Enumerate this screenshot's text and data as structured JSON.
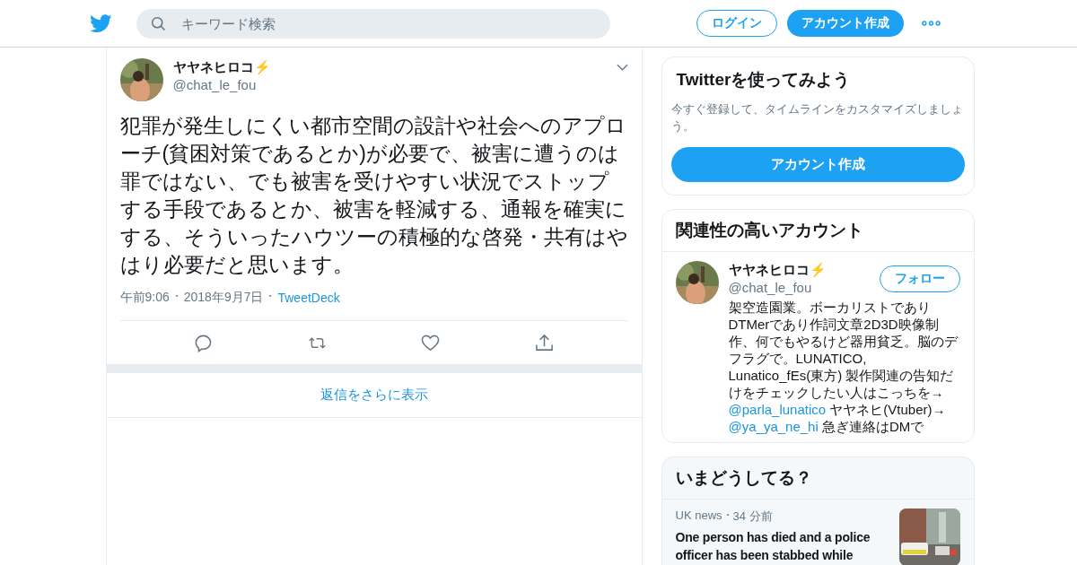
{
  "header": {
    "search": {
      "placeholder": "キーワード検索"
    },
    "login": "ログイン",
    "signup": "アカウント作成"
  },
  "tweet": {
    "name": "ヤヤネヒロコ⚡",
    "handle": "@chat_le_fou",
    "text": "犯罪が発生しにくい都市空間の設計や社会へのアプローチ(貧困対策であるとか)が必要で、被害に遭うのは罪ではない、でも被害を受けやすい状況でストップする手段であるとか、被害を軽減する、通報を確実にする、そういったハウツーの積極的な啓発・共有はやはり必要だと思います。",
    "time": "午前9:06",
    "date": "2018年9月7日",
    "source": "TweetDeck"
  },
  "more_replies": "返信をさらに表示",
  "signup_card": {
    "title": "Twitterを使ってみよう",
    "text": "今すぐ登録して、タイムラインをカスタマイズしましょう。",
    "button": "アカウント作成"
  },
  "related": {
    "title": "関連性の高いアカウント",
    "account": {
      "name": "ヤヤネヒロコ⚡",
      "handle": "@chat_le_fou",
      "follow": "フォロー",
      "bio": [
        {
          "kind": "text",
          "text": "架空造園業。ボーカリストでありDTMerであり作詞文章2D3D映像制作、何でもやるけど器用貧乏。脳のデフラグで。LUNATICO, Lunatico_fEs(東方) 製作関連の告知だけをチェックしたい人はこっちを→ "
        },
        {
          "kind": "mention",
          "text": "@parla_lunatico"
        },
        {
          "kind": "text",
          "text": " ヤヤネヒ(Vtuber)→ "
        },
        {
          "kind": "mention",
          "text": "@ya_ya_ne_hi"
        },
        {
          "kind": "text",
          "text": " 急ぎ連絡はDMで"
        }
      ]
    }
  },
  "trends": {
    "title": "いまどうしてる？",
    "item": {
      "category": "UK news",
      "time": "34 分前",
      "headline": "One person has died and a police officer has been stabbed while"
    }
  }
}
